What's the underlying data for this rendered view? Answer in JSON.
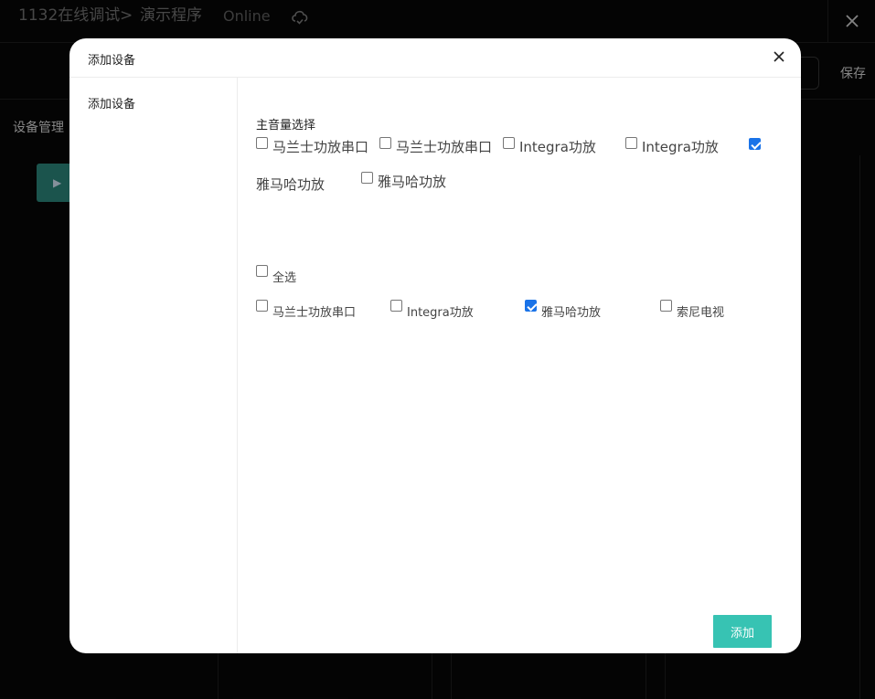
{
  "topbar": {
    "project": "1132在线调试",
    "separator": ">",
    "program": "演示程序",
    "status": "Online",
    "cloud_icon": "cloud-sync-icon",
    "close_icon": "close-icon"
  },
  "toolbar": {
    "save_label": "保存"
  },
  "left_panel": {
    "device_management": "设备管理"
  },
  "modal": {
    "title": "添加设备",
    "side_items": [
      "添加设备"
    ],
    "master_volume": {
      "label": "主音量选择",
      "options": [
        {
          "label": "马兰士功放串口",
          "checked": false
        },
        {
          "label": "马兰士功放串口",
          "checked": false
        },
        {
          "label": "Integra功放",
          "checked": false
        },
        {
          "label": "Integra功放",
          "checked": false
        },
        {
          "label": "雅马哈功放",
          "checked": true
        },
        {
          "label": "雅马哈功放",
          "checked": false
        }
      ]
    },
    "select_all": {
      "label": "全选",
      "checked": false
    },
    "devices": [
      {
        "label": "马兰士功放串口",
        "checked": false
      },
      {
        "label": "Integra功放",
        "checked": false
      },
      {
        "label": "雅马哈功放",
        "checked": true
      },
      {
        "label": "索尼电视",
        "checked": false
      }
    ],
    "add_button": "添加"
  },
  "colors": {
    "accent": "#37c3b3",
    "checkbox_checked": "#1a73e8"
  }
}
